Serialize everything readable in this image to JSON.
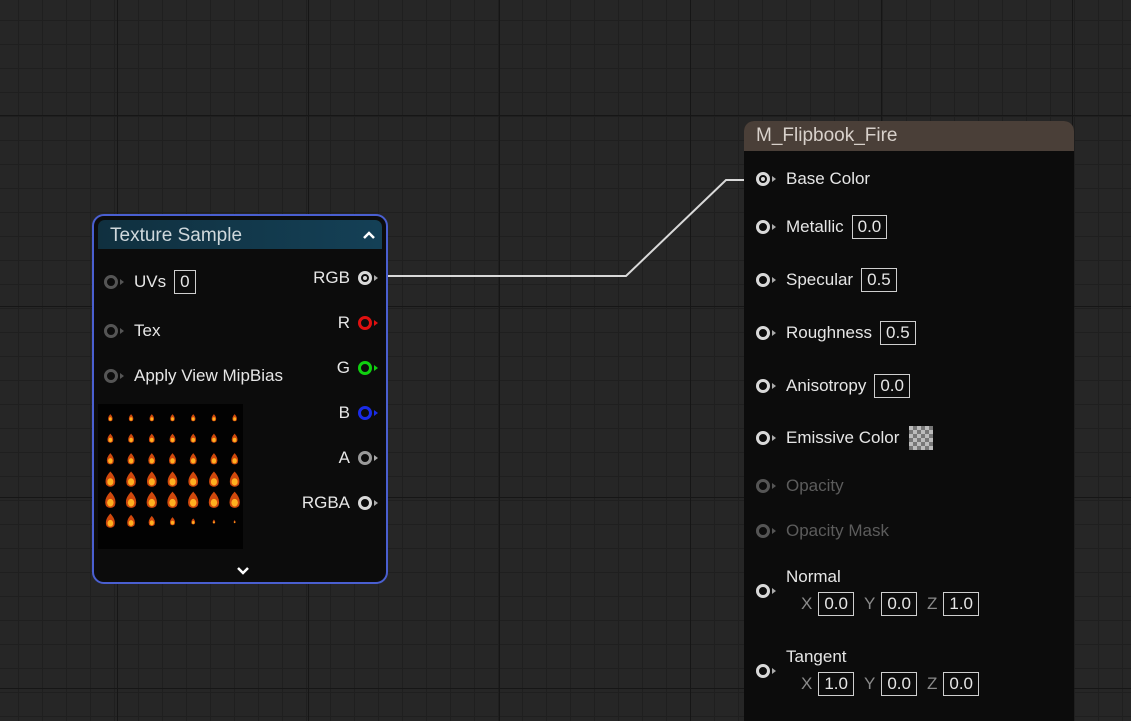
{
  "texture_sample": {
    "title": "Texture Sample",
    "inputs": {
      "uvs_label": "UVs",
      "uvs_value": "0",
      "tex_label": "Tex",
      "mipbias_label": "Apply View MipBias"
    },
    "outputs": {
      "rgb": "RGB",
      "r": "R",
      "g": "G",
      "b": "B",
      "a": "A",
      "rgba": "RGBA"
    },
    "pin_colors": {
      "r": "#e01010",
      "g": "#10d010",
      "b": "#1a2ce8",
      "a": "#9a9a9a",
      "default": "#d9d9d9"
    }
  },
  "material": {
    "title": "M_Flipbook_Fire",
    "base_color": "Base Color",
    "metallic": {
      "label": "Metallic",
      "value": "0.0"
    },
    "specular": {
      "label": "Specular",
      "value": "0.5"
    },
    "roughness": {
      "label": "Roughness",
      "value": "0.5"
    },
    "anisotropy": {
      "label": "Anisotropy",
      "value": "0.0"
    },
    "emissive": {
      "label": "Emissive Color"
    },
    "opacity": {
      "label": "Opacity"
    },
    "opacity_mask": {
      "label": "Opacity Mask"
    },
    "normal": {
      "label": "Normal",
      "x_label": "X",
      "x": "0.0",
      "y_label": "Y",
      "y": "0.0",
      "z_label": "Z",
      "z": "1.0"
    },
    "tangent": {
      "label": "Tangent",
      "x_label": "X",
      "x": "1.0",
      "y_label": "Y",
      "y": "0.0",
      "z_label": "Z",
      "z": "0.0"
    }
  },
  "colors": {
    "canvas_bg": "#262626",
    "node_bg": "#0c0c0c",
    "texture_header": "#144056",
    "texture_selection_border": "#4a5fd0",
    "material_header": "#4a3f38",
    "wire": "#d9d9d9"
  }
}
